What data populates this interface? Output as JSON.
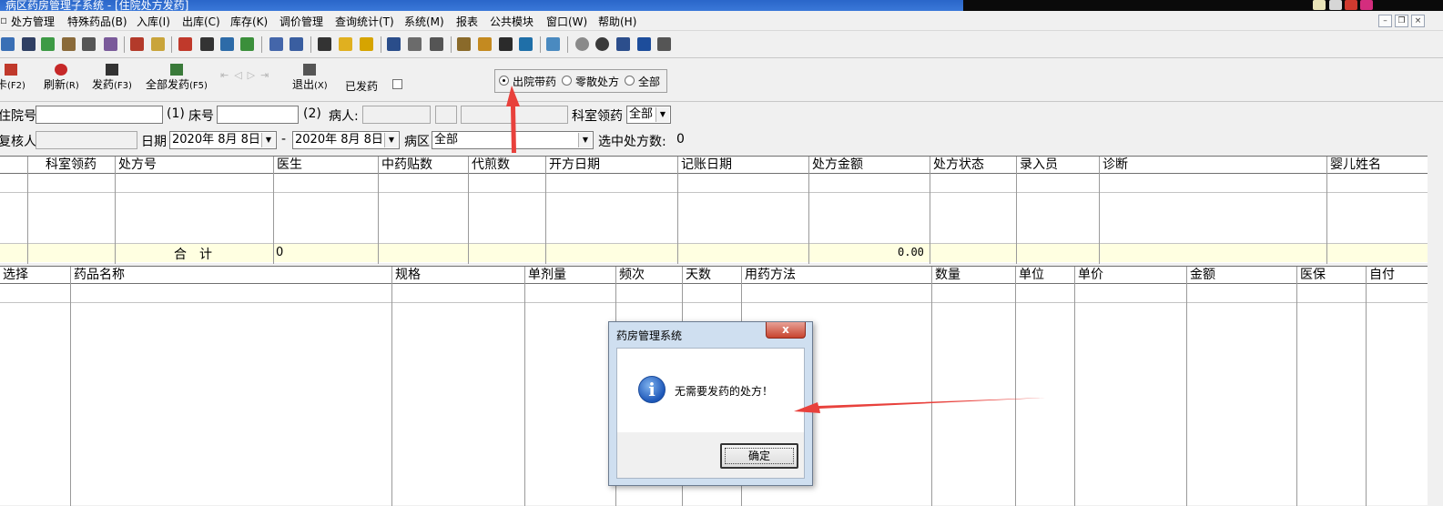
{
  "titlebar": {
    "title": "病区药房管理子系统 - [住院处方发药]"
  },
  "menu": [
    "处方管理",
    "特殊药品(B)",
    "入库(I)",
    "出库(C)",
    "库存(K)",
    "调价管理",
    "查询统计(T)",
    "系统(M)",
    "报表",
    "公共模块",
    "窗口(W)",
    "帮助(H)"
  ],
  "actions": {
    "card": {
      "label": "卡",
      "hotkey": "(F2)"
    },
    "refresh": {
      "label": "刷新",
      "hotkey": "(R)"
    },
    "dispense": {
      "label": "发药",
      "hotkey": "(F3)"
    },
    "dispense_all": {
      "label": "全部发药",
      "hotkey": "(F5)"
    },
    "exit": {
      "label": "退出",
      "hotkey": "(X)"
    },
    "dispensed_label": "已发药"
  },
  "radios": {
    "opt1": "出院带药",
    "opt2": "零散处方",
    "opt3": "全部"
  },
  "filters": {
    "inpatient_no_label": "住院号",
    "inpatient_no_hint": "(1)",
    "bed_no_label": "床号",
    "bed_no_hint": "(2)",
    "patient_label": "病人:",
    "dept_collect_label": "科室领药",
    "dept_collect_value": "全部",
    "reviewer_label": "复核人",
    "date_label": "日期",
    "date_from": "2020年 8月 8日",
    "date_sep": "-",
    "date_to": "2020年 8月 8日",
    "ward_label": "病区",
    "ward_value": "全部",
    "selected_label": "选中处方数:",
    "selected_count": "0"
  },
  "rx_table": {
    "headers": [
      "科室领药",
      "处方号",
      "医生",
      "中药贴数",
      "代煎数",
      "开方日期",
      "记账日期",
      "处方金额",
      "处方状态",
      "录入员",
      "诊断",
      "婴儿姓名"
    ],
    "summary_label": "合　计",
    "summary_count": "0",
    "summary_amount": "0.00"
  },
  "drug_table": {
    "headers": [
      "选择",
      "药品名称",
      "规格",
      "单剂量",
      "频次",
      "天数",
      "用药方法",
      "数量",
      "单位",
      "单价",
      "金额",
      "医保",
      "自付"
    ]
  },
  "dialog": {
    "title": "药房管理系统",
    "close": "x",
    "message": "无需要发药的处方！",
    "ok": "确定"
  },
  "colors": {
    "arrow": "#e8413c",
    "titlebar": "#2a66c9",
    "summary_row": "#ffffe1"
  }
}
